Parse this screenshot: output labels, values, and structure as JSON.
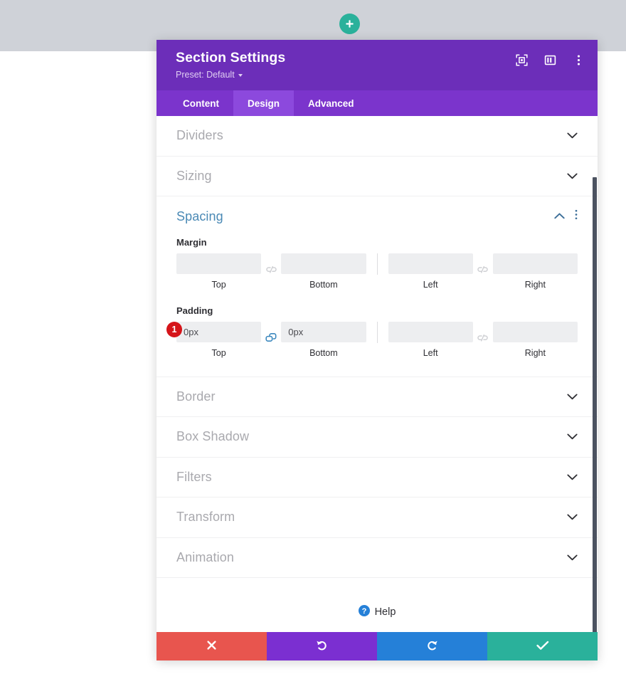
{
  "canvas": {
    "add_button_icon": "plus-icon",
    "top_band_color": "#cfd2d8",
    "accent_green": "#2ab19b"
  },
  "panel": {
    "header": {
      "title": "Section Settings",
      "preset_label": "Preset: Default",
      "icons": [
        {
          "name": "focus-target-icon",
          "label": "Focus"
        },
        {
          "name": "layout-panel-icon",
          "label": "Layout"
        },
        {
          "name": "kebab-menu-icon",
          "label": "More options"
        }
      ],
      "background_color": "#6c2eb9"
    },
    "tabs": [
      {
        "label": "Content",
        "active": false
      },
      {
        "label": "Design",
        "active": true
      },
      {
        "label": "Advanced",
        "active": false
      }
    ],
    "sections_above": [
      {
        "label": "Dividers",
        "expanded": false
      },
      {
        "label": "Sizing",
        "expanded": false
      }
    ],
    "spacing": {
      "label": "Spacing",
      "expanded": true,
      "accent_color": "#4a89b5",
      "margin": {
        "label": "Margin",
        "linked": false,
        "link_icon": "chain-broken-icon",
        "fields": [
          {
            "caption": "Top",
            "value": "",
            "placeholder": ""
          },
          {
            "caption": "Bottom",
            "value": "",
            "placeholder": ""
          },
          {
            "caption": "Left",
            "value": "",
            "placeholder": ""
          },
          {
            "caption": "Right",
            "value": "",
            "placeholder": ""
          }
        ]
      },
      "padding": {
        "label": "Padding",
        "linked": true,
        "link_icon_left": "chain-linked-icon",
        "link_icon_right": "chain-broken-icon",
        "badge": "1",
        "badge_color": "#d51419",
        "fields": [
          {
            "caption": "Top",
            "value": "0px",
            "placeholder": ""
          },
          {
            "caption": "Bottom",
            "value": "0px",
            "placeholder": ""
          },
          {
            "caption": "Left",
            "value": "",
            "placeholder": ""
          },
          {
            "caption": "Right",
            "value": "",
            "placeholder": ""
          }
        ]
      }
    },
    "sections_below": [
      {
        "label": "Border",
        "expanded": false
      },
      {
        "label": "Box Shadow",
        "expanded": false
      },
      {
        "label": "Filters",
        "expanded": false
      },
      {
        "label": "Transform",
        "expanded": false
      },
      {
        "label": "Animation",
        "expanded": false
      }
    ],
    "help": {
      "label": "Help",
      "icon": "question-circle-icon",
      "icon_color": "#2580d8"
    },
    "footer": [
      {
        "name": "close",
        "icon": "x-icon",
        "color": "#e8554e"
      },
      {
        "name": "undo",
        "icon": "undo-arrow-icon",
        "color": "#7b2fd1"
      },
      {
        "name": "redo",
        "icon": "redo-arrow-icon",
        "color": "#2580d8"
      },
      {
        "name": "save",
        "icon": "check-icon",
        "color": "#2ab19b"
      }
    ]
  }
}
